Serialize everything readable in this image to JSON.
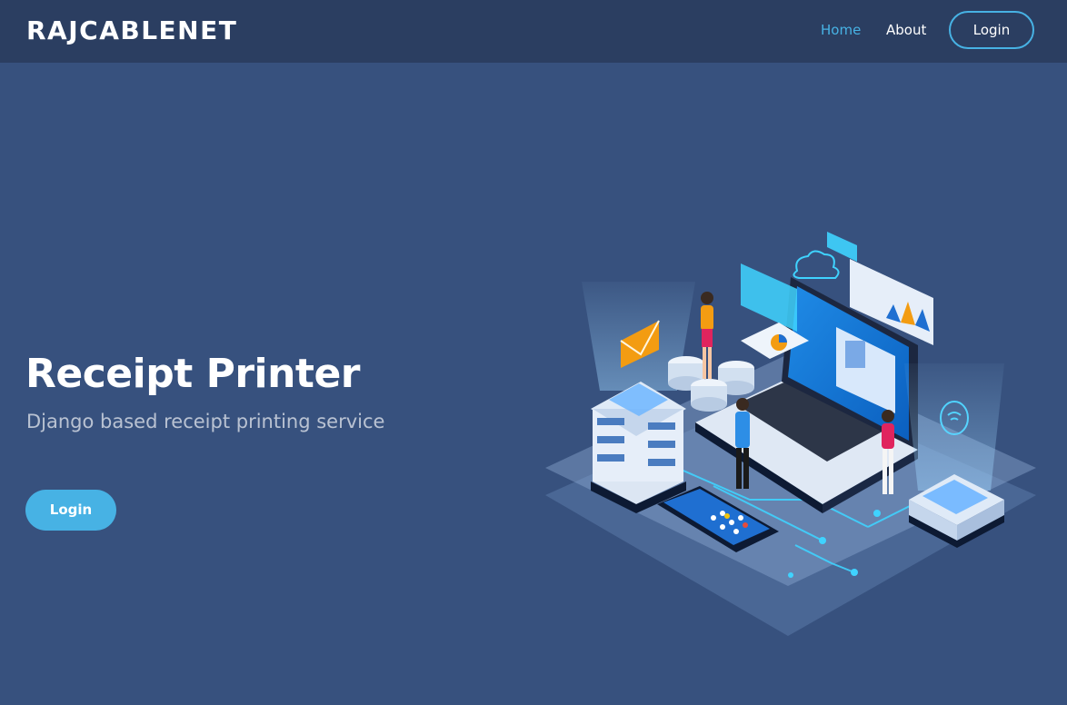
{
  "navbar": {
    "logo": "RAJCABLENET",
    "links": [
      {
        "label": "Home",
        "active": true
      },
      {
        "label": "About",
        "active": false
      }
    ],
    "login_label": "Login"
  },
  "hero": {
    "title": "Receipt Printer",
    "subtitle": "Django based receipt printing service",
    "button_label": "Login",
    "illustration_icon": "isometric-network-illustration"
  },
  "colors": {
    "background": "#37517e",
    "navbar": "#2b3e61",
    "accent": "#47b2e4",
    "text": "#ffffff"
  }
}
